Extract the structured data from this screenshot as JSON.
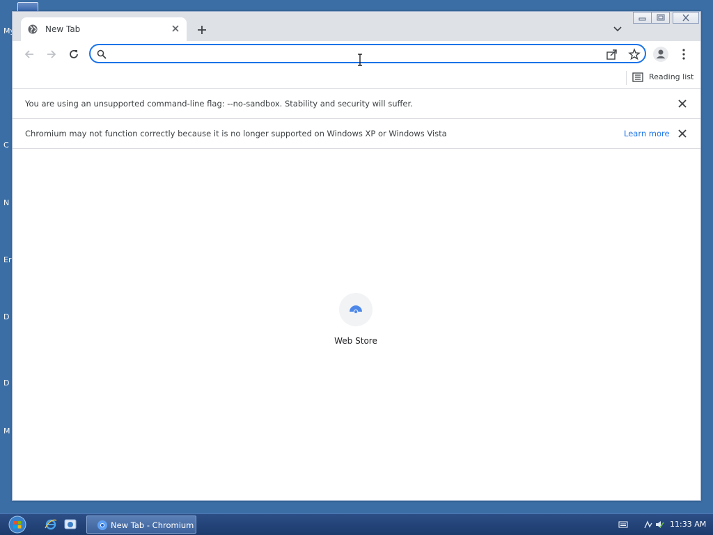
{
  "desktop": {
    "edge_letters": [
      "My",
      "C",
      "N",
      "Er",
      "D",
      "D",
      "M"
    ]
  },
  "browser": {
    "tab": {
      "title": "New Tab"
    },
    "toolbar": {
      "omnibox_value": "",
      "omnibox_placeholder": ""
    },
    "bookmarks": {
      "reading_list_label": "Reading list"
    },
    "infobars": [
      {
        "message": "You are using an unsupported command-line flag: --no-sandbox. Stability and security will suffer."
      },
      {
        "message": "Chromium may not function correctly because it is no longer supported on Windows XP or Windows Vista",
        "link": "Learn more"
      }
    ],
    "shortcuts": [
      {
        "label": "Web Store",
        "icon": "web-store-icon"
      }
    ]
  },
  "taskbar": {
    "active_window": "New Tab - Chromium",
    "clock": "11:33 AM"
  },
  "colors": {
    "desktop_bg": "#3b6ea5",
    "accent": "#1a73e8",
    "tabstrip_bg": "#dee1e6"
  }
}
